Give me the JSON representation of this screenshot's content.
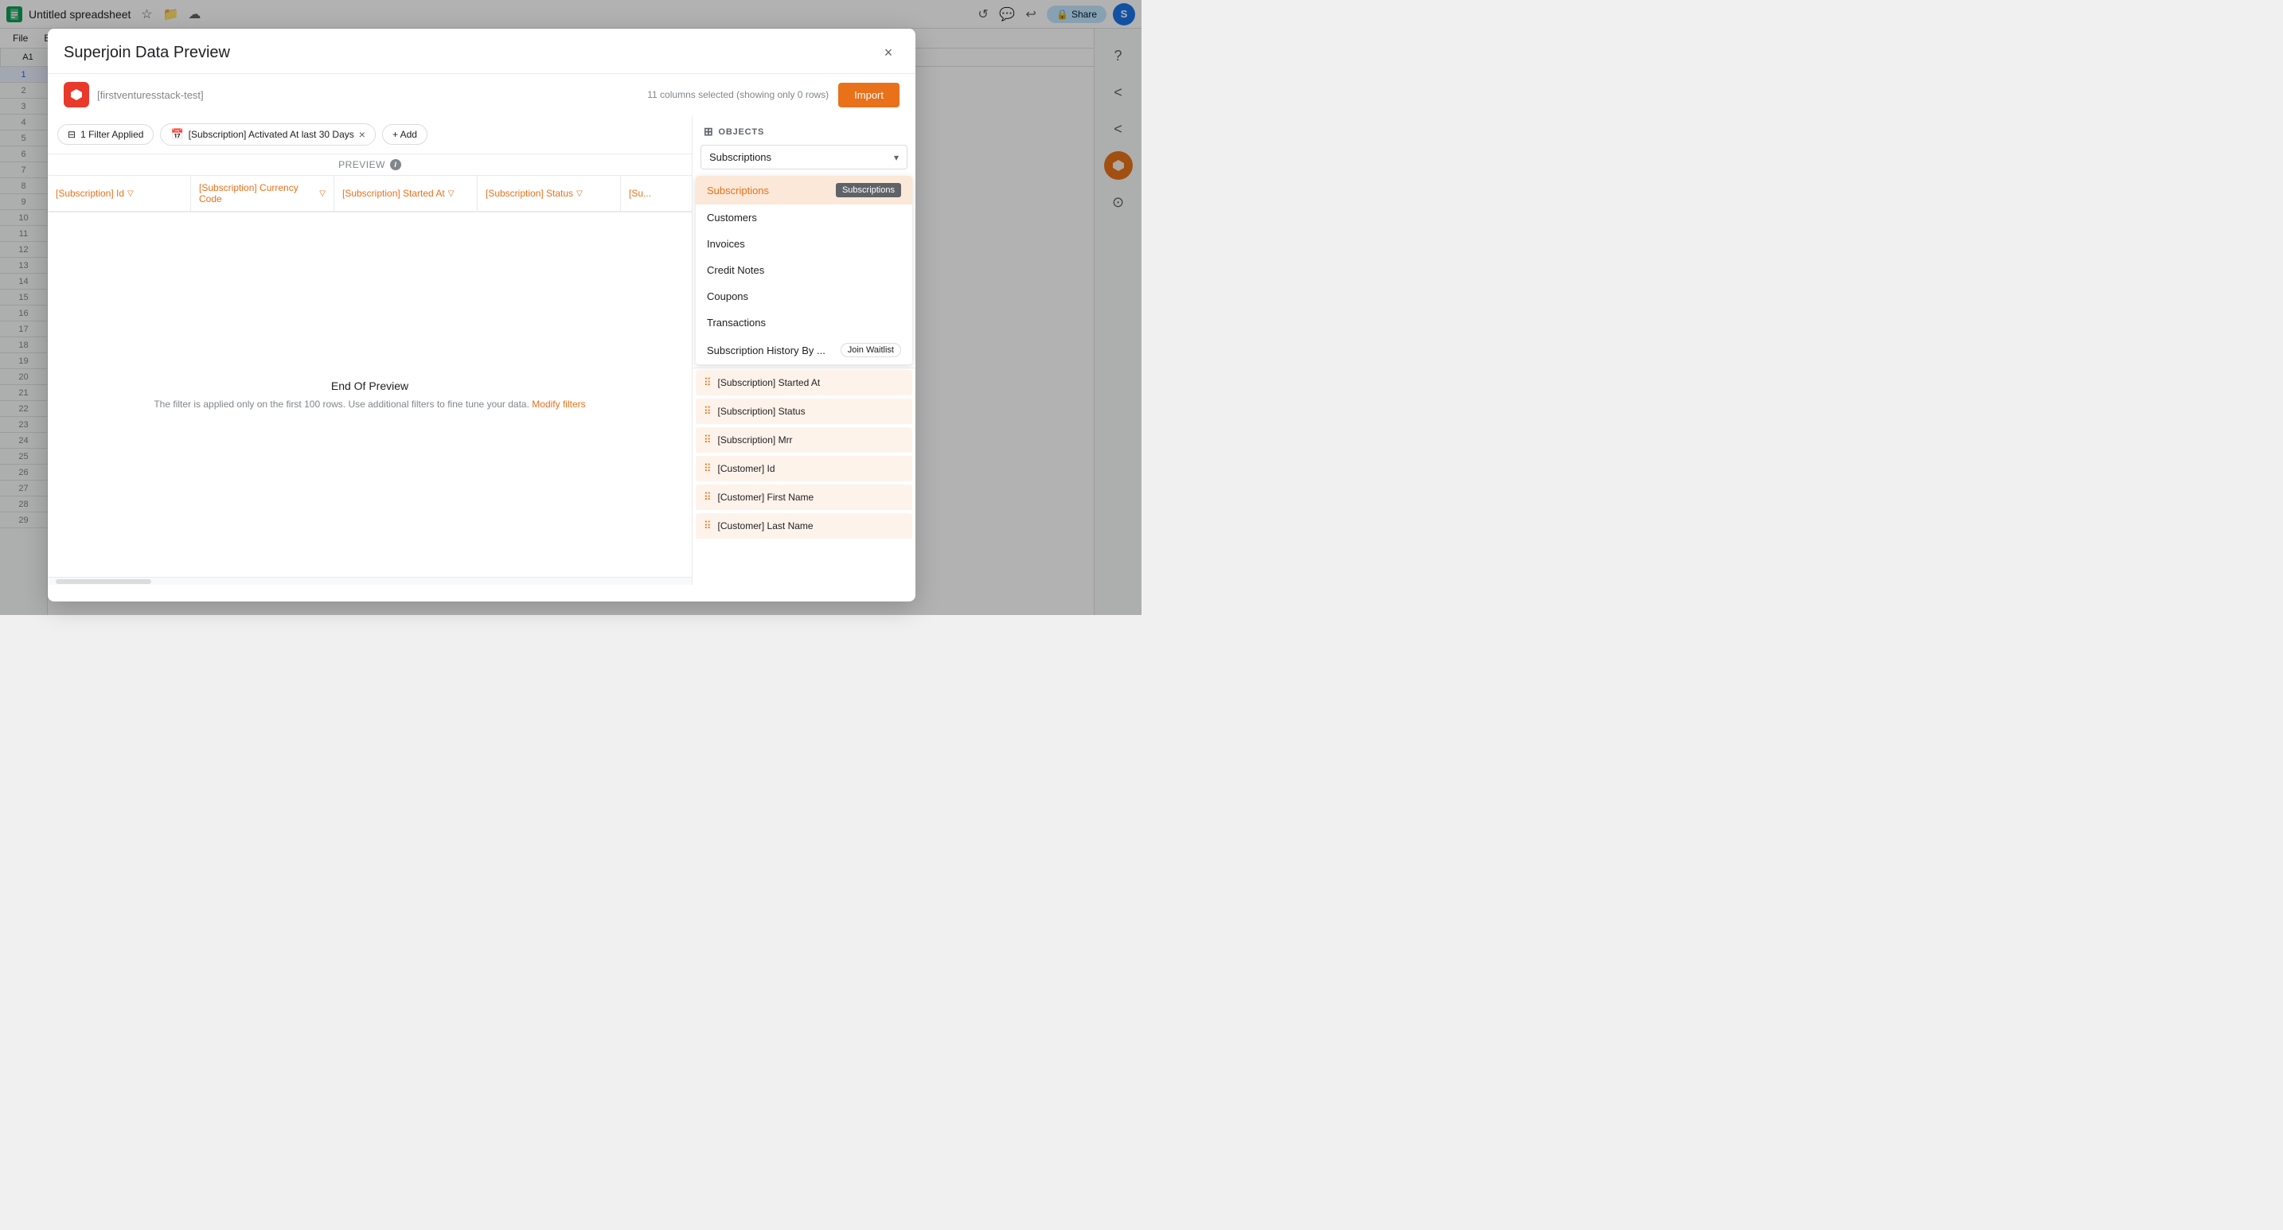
{
  "app": {
    "title": "Untitled spreadsheet",
    "cellRef": "A1",
    "shareLabel": "Share"
  },
  "menu": {
    "items": [
      "File",
      "Edit"
    ]
  },
  "dialog": {
    "title": "Superjoin Data Preview",
    "closeLabel": "×",
    "connectorName": "[firstventuresstack-test]",
    "columnsInfo": "11 columns selected (showing only 0 rows)",
    "importLabel": "Import"
  },
  "filterBar": {
    "filterLabel": "1 Filter Applied",
    "dateFilter": "[Subscription] Activated At  last  30 Days",
    "addLabel": "+ Add"
  },
  "preview": {
    "label": "PREVIEW",
    "tableHeaders": [
      "[Subscription] Id",
      "[Subscription] Currency Code",
      "[Subscription] Started At",
      "[Subscription] Status",
      "[Su..."
    ],
    "endTitle": "End Of Preview",
    "endText": "The filter is applied only on the first 100 rows. Use additional filters to fine tune your data.",
    "modifyLink": "Modify filters"
  },
  "objects": {
    "panelTitle": "OBJECTS",
    "selectorValue": "Subscriptions",
    "items": [
      {
        "label": "Subscriptions",
        "selected": true,
        "tooltip": "Subscriptions"
      },
      {
        "label": "Customers",
        "selected": false
      },
      {
        "label": "Invoices",
        "selected": false
      },
      {
        "label": "Credit Notes",
        "selected": false
      },
      {
        "label": "Coupons",
        "selected": false
      },
      {
        "label": "Transactions",
        "selected": false
      },
      {
        "label": "Subscription History By ...",
        "selected": false,
        "badge": "Join Waitlist"
      }
    ],
    "columns": [
      "[Subscription] Started At",
      "[Subscription] Status",
      "[Subscription] Mrr",
      "[Customer] Id",
      "[Customer] First Name",
      "[Customer] Last Name"
    ]
  },
  "rows": [
    "1",
    "2",
    "3",
    "4",
    "5",
    "6",
    "7",
    "8",
    "9",
    "10",
    "11",
    "12",
    "13",
    "14",
    "15",
    "16",
    "17",
    "18",
    "19",
    "20",
    "21",
    "22",
    "23",
    "24",
    "25",
    "26",
    "27",
    "28",
    "29"
  ],
  "avatar": "S"
}
